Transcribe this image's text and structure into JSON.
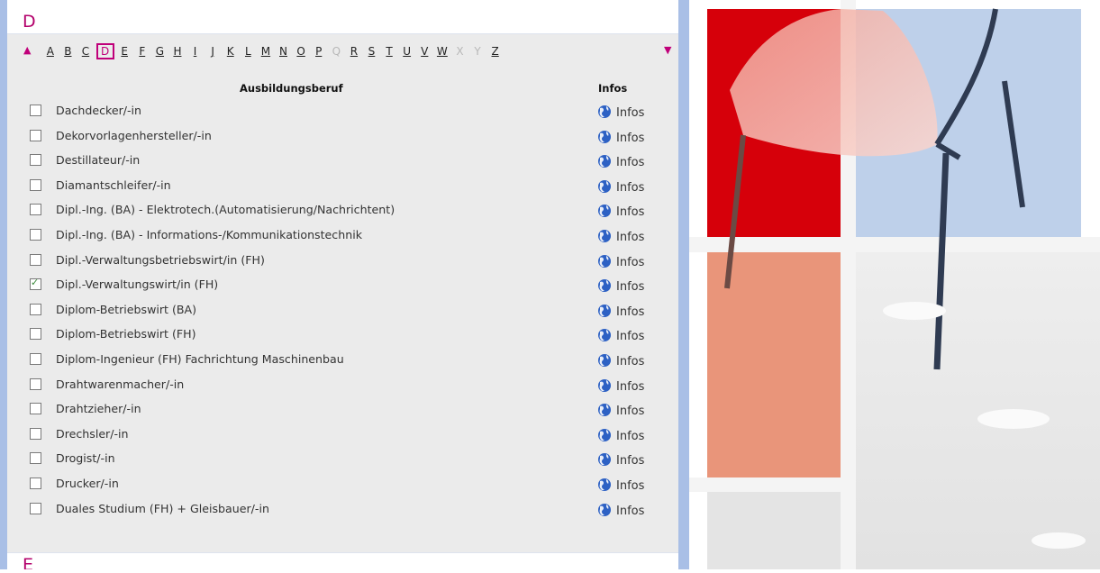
{
  "section": {
    "letter": "D",
    "next_letter": "E"
  },
  "alphabet": [
    {
      "l": "A",
      "s": "link"
    },
    {
      "l": "B",
      "s": "link"
    },
    {
      "l": "C",
      "s": "link"
    },
    {
      "l": "D",
      "s": "current"
    },
    {
      "l": "E",
      "s": "link"
    },
    {
      "l": "F",
      "s": "link"
    },
    {
      "l": "G",
      "s": "link"
    },
    {
      "l": "H",
      "s": "link"
    },
    {
      "l": "I",
      "s": "link"
    },
    {
      "l": "J",
      "s": "link"
    },
    {
      "l": "K",
      "s": "link"
    },
    {
      "l": "L",
      "s": "link"
    },
    {
      "l": "M",
      "s": "link"
    },
    {
      "l": "N",
      "s": "link"
    },
    {
      "l": "O",
      "s": "link"
    },
    {
      "l": "P",
      "s": "link"
    },
    {
      "l": "Q",
      "s": "disabled"
    },
    {
      "l": "R",
      "s": "link"
    },
    {
      "l": "S",
      "s": "link"
    },
    {
      "l": "T",
      "s": "link"
    },
    {
      "l": "U",
      "s": "link"
    },
    {
      "l": "V",
      "s": "link"
    },
    {
      "l": "W",
      "s": "link"
    },
    {
      "l": "X",
      "s": "disabled"
    },
    {
      "l": "Y",
      "s": "disabled"
    },
    {
      "l": "Z",
      "s": "link"
    }
  ],
  "table": {
    "header_beruf": "Ausbildungsberuf",
    "header_infos": "Infos",
    "rows": [
      {
        "label": "Dachdecker/-in",
        "checked": false,
        "info": "Infos"
      },
      {
        "label": "Dekorvorlagenhersteller/-in",
        "checked": false,
        "info": "Infos"
      },
      {
        "label": "Destillateur/-in",
        "checked": false,
        "info": "Infos"
      },
      {
        "label": "Diamantschleifer/-in",
        "checked": false,
        "info": "Infos"
      },
      {
        "label": "Dipl.-Ing. (BA) - Elektrotech.(Automatisierung/Nachrichtent)",
        "checked": false,
        "info": "Infos"
      },
      {
        "label": "Dipl.-Ing. (BA) - Informations-/Kommunikationstechnik",
        "checked": false,
        "info": "Infos"
      },
      {
        "label": "Dipl.-Verwaltungsbetriebswirt/in (FH)",
        "checked": false,
        "info": "Infos"
      },
      {
        "label": "Dipl.-Verwaltungswirt/in (FH)",
        "checked": true,
        "info": "Infos"
      },
      {
        "label": "Diplom-Betriebswirt (BA)",
        "checked": false,
        "info": "Infos"
      },
      {
        "label": "Diplom-Betriebswirt (FH)",
        "checked": false,
        "info": "Infos"
      },
      {
        "label": "Diplom-Ingenieur (FH) Fachrichtung Maschinenbau",
        "checked": false,
        "info": "Infos"
      },
      {
        "label": "Drahtwarenmacher/-in",
        "checked": false,
        "info": "Infos"
      },
      {
        "label": "Drahtzieher/-in",
        "checked": false,
        "info": "Infos"
      },
      {
        "label": "Drechsler/-in",
        "checked": false,
        "info": "Infos"
      },
      {
        "label": "Drogist/-in",
        "checked": false,
        "info": "Infos"
      },
      {
        "label": "Drucker/-in",
        "checked": false,
        "info": "Infos"
      },
      {
        "label": "Duales Studium (FH) + Gleisbauer/-in",
        "checked": false,
        "info": "Infos"
      }
    ]
  },
  "colors": {
    "accent": "#b3006b",
    "stripe": "#a9bfe6",
    "panel_bg": "#ebebeb",
    "red": "#d6000a",
    "salmon": "#e9957a",
    "light_blue": "#bed0ea",
    "light_gray": "#e6e7e8"
  }
}
